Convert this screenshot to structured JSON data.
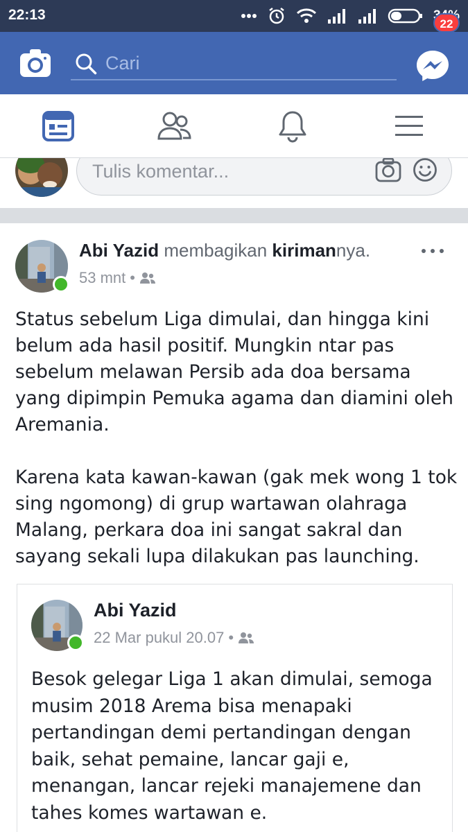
{
  "status_bar": {
    "time": "22:13",
    "battery": "34%"
  },
  "header": {
    "search_placeholder": "Cari",
    "messenger_badge": "22"
  },
  "tabs": [
    {
      "name": "news-feed",
      "icon": "news-feed-icon",
      "active": true
    },
    {
      "name": "friends",
      "icon": "friends-icon",
      "active": false
    },
    {
      "name": "notifications",
      "icon": "bell-icon",
      "active": false
    },
    {
      "name": "menu",
      "icon": "hamburger-icon",
      "active": false
    }
  ],
  "comment": {
    "placeholder": "Tulis komentar..."
  },
  "post": {
    "author": "Abi Yazid",
    "action": " membagikan ",
    "object": "kiriman",
    "object_suffix": "nya.",
    "time": "53 mnt",
    "separator": "•",
    "paragraphs": [
      "Status sebelum Liga dimulai, dan hingga kini belum ada hasil positif. Mungkin ntar pas sebelum melawan Persib ada doa bersama yang dipimpin Pemuka agama dan diamini oleh Aremania.",
      "Karena kata kawan-kawan (gak mek wong 1 tok sing ngomong) di grup wartawan olahraga Malang, perkara doa ini sangat sakral dan sayang sekali lupa dilakukan pas launching."
    ],
    "shared": {
      "author": "Abi Yazid",
      "time": "22 Mar pukul 20.07",
      "separator": "•",
      "text": "Besok gelegar Liga 1 akan dimulai, semoga musim 2018 Arema bisa menapaki pertandingan demi pertandingan dengan baik, sehat pemaine, lancar gaji e, menangan, lancar rejeki manajemene dan tahes komes wartawan e."
    }
  },
  "colors": {
    "brand": "#4267b2",
    "status_bar": "#2d3a56",
    "online": "#42b72a",
    "badge": "#fa3e3e"
  }
}
